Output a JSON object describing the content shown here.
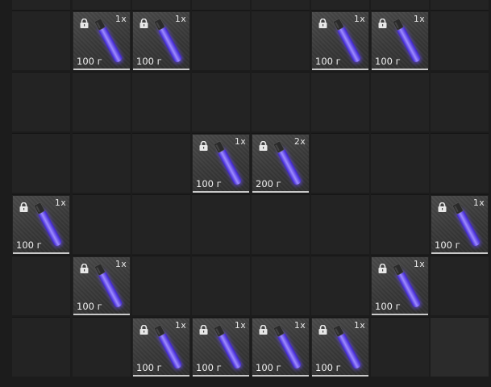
{
  "inventory": {
    "columns": 8,
    "rows": 6,
    "icons": {
      "item": "purple-glowstick-icon",
      "lock": "padlock-icon"
    },
    "colors": {
      "stick": "#6b4dff",
      "stick_glow": "#9d8bff",
      "cap": "#2a2a2a"
    },
    "items": [
      {
        "row": 0,
        "col": 1,
        "qty": "1x",
        "weight": "100 г"
      },
      {
        "row": 0,
        "col": 2,
        "qty": "1x",
        "weight": "100 г"
      },
      {
        "row": 0,
        "col": 5,
        "qty": "1x",
        "weight": "100 г"
      },
      {
        "row": 0,
        "col": 6,
        "qty": "1x",
        "weight": "100 г"
      },
      {
        "row": 2,
        "col": 3,
        "qty": "1x",
        "weight": "100 г"
      },
      {
        "row": 2,
        "col": 4,
        "qty": "2x",
        "weight": "200 г"
      },
      {
        "row": 3,
        "col": 0,
        "qty": "1x",
        "weight": "100 г"
      },
      {
        "row": 3,
        "col": 7,
        "qty": "1x",
        "weight": "100 г"
      },
      {
        "row": 4,
        "col": 1,
        "qty": "1x",
        "weight": "100 г"
      },
      {
        "row": 4,
        "col": 6,
        "qty": "1x",
        "weight": "100 г"
      },
      {
        "row": 5,
        "col": 2,
        "qty": "1x",
        "weight": "100 г"
      },
      {
        "row": 5,
        "col": 3,
        "qty": "1x",
        "weight": "100 г"
      },
      {
        "row": 5,
        "col": 4,
        "qty": "1x",
        "weight": "100 г"
      },
      {
        "row": 5,
        "col": 5,
        "qty": "1x",
        "weight": "100 г"
      }
    ]
  }
}
